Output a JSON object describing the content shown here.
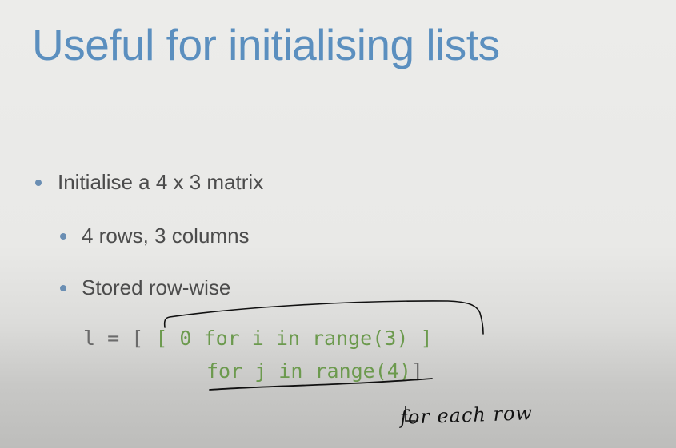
{
  "slide": {
    "title": "Useful for initialising lists",
    "bullets": [
      {
        "level": 1,
        "text": "Initialise a 4 x 3 matrix"
      },
      {
        "level": 2,
        "text": "4 rows, 3 columns"
      },
      {
        "level": 2,
        "text": "Stored row-wise"
      }
    ],
    "code": {
      "line1": {
        "lhs": "l = [ ",
        "inner": "[ 0 for i in range(3) ]"
      },
      "line2": {
        "outer": "for j in range(4)",
        "close": "]"
      }
    },
    "annotation": "for each row"
  },
  "colors": {
    "title": "#5b8fbf",
    "bullet_dot": "#6a8eb3",
    "code_green": "#6c9a4e",
    "code_gray": "#6b6b6b",
    "ink": "#111111"
  }
}
